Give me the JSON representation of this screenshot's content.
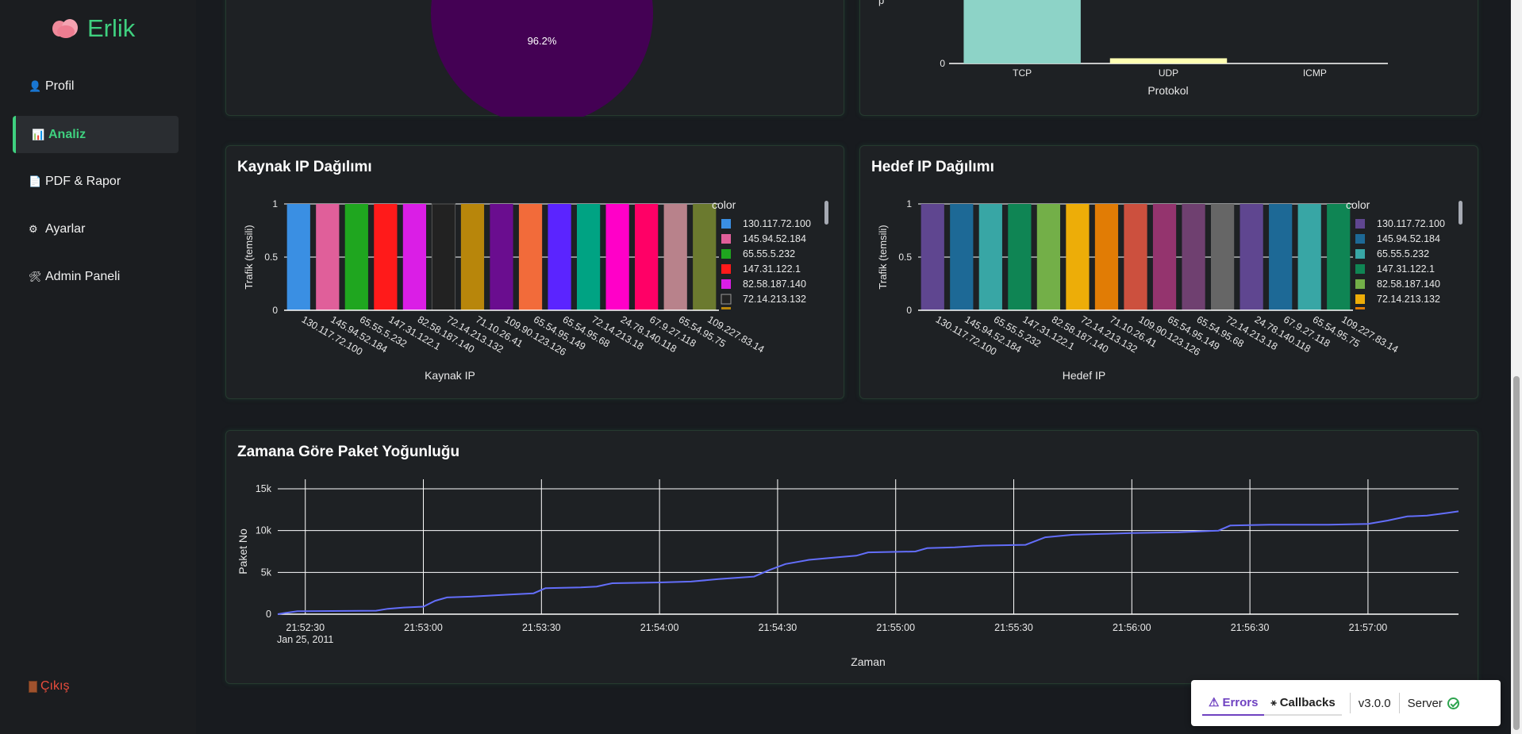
{
  "app": {
    "brand": "Erlik",
    "nav": [
      {
        "label": "Profil",
        "icon": "user-icon",
        "glyph": "👤"
      },
      {
        "label": "Analiz",
        "icon": "bar-chart-icon",
        "glyph": "📊"
      },
      {
        "label": "PDF & Rapor",
        "icon": "document-icon",
        "glyph": "📄"
      },
      {
        "label": "Ayarlar",
        "icon": "gear-icon",
        "glyph": "⚙"
      },
      {
        "label": "Admin Paneli",
        "icon": "tools-icon",
        "glyph": "🛠"
      }
    ],
    "logout": "Çıkış"
  },
  "pie_card": {
    "slice_label": "96.2%",
    "slice_color": "#440154"
  },
  "protocol_card": {
    "chart_data": {
      "type": "bar",
      "categories": [
        "TCP",
        "UDP",
        "ICMP"
      ],
      "values": [
        1,
        0.05,
        0
      ],
      "colors": [
        "#8dd3c7",
        "#ffffb3",
        "#bebada"
      ],
      "xlabel": "Protokol",
      "y_tick_visible": "0"
    }
  },
  "source_ip_card": {
    "title": "Kaynak IP Dağılımı",
    "chart_data": {
      "type": "bar",
      "categories": [
        "130.117.72.100",
        "145.94.52.184",
        "65.55.5.232",
        "147.31.122.1",
        "82.58.187.140",
        "72.14.213.132",
        "71.10.26.41",
        "109.90.123.126",
        "65.54.95.149",
        "65.54.95.68",
        "72.14.213.18",
        "24.78.140.118",
        "67.9.27.118",
        "65.54.95.75",
        "109.227.83.14"
      ],
      "values": [
        1,
        1,
        1,
        1,
        1,
        1,
        1,
        1,
        1,
        1,
        1,
        1,
        1,
        1,
        1
      ],
      "colors": [
        "#3a8fe3",
        "#e05f9a",
        "#1fa61f",
        "#ff1a1a",
        "#da1ee6",
        "#222222",
        "#b8860b",
        "#6a0d8f",
        "#f26b3a",
        "#5b24ff",
        "#00a383",
        "#ff00c8",
        "#ff0066",
        "#b8828b",
        "#6b7a2f"
      ],
      "xlabel": "Kaynak IP",
      "ylabel": "Trafik (temsili)",
      "yticks": [
        "0",
        "0.5",
        "1"
      ],
      "legend_title": "color",
      "legend_visible": [
        "130.117.72.100",
        "145.94.52.184",
        "65.55.5.232",
        "147.31.122.1",
        "82.58.187.140",
        "72.14.213.132"
      ]
    }
  },
  "dest_ip_card": {
    "title": "Hedef IP Dağılımı",
    "chart_data": {
      "type": "bar",
      "categories": [
        "130.117.72.100",
        "145.94.52.184",
        "65.55.5.232",
        "147.31.122.1",
        "82.58.187.140",
        "72.14.213.132",
        "71.10.26.41",
        "109.90.123.126",
        "65.54.95.149",
        "65.54.95.68",
        "72.14.213.18",
        "24.78.140.118",
        "67.9.27.118",
        "65.54.95.75",
        "109.227.83.14"
      ],
      "values": [
        1,
        1,
        1,
        1,
        1,
        1,
        1,
        1,
        1,
        1,
        1,
        1,
        1,
        1,
        1
      ],
      "colors": [
        "#5f4690",
        "#1d6996",
        "#38a6a5",
        "#0f8554",
        "#73af48",
        "#edad08",
        "#e17c05",
        "#cc503e",
        "#94346e",
        "#6f4070",
        "#666666",
        "#5f4690",
        "#1d6996",
        "#38a6a5",
        "#0f8554"
      ],
      "xlabel": "Hedef IP",
      "ylabel": "Trafik (temsili)",
      "yticks": [
        "0",
        "0.5",
        "1"
      ],
      "legend_title": "color",
      "legend_visible": [
        "130.117.72.100",
        "145.94.52.184",
        "65.55.5.232",
        "147.31.122.1",
        "82.58.187.140",
        "72.14.213.132"
      ]
    }
  },
  "timeline_card": {
    "title": "Zamana Göre Paket Yoğunluğu",
    "chart_data": {
      "type": "line",
      "xlabel": "Zaman",
      "ylabel": "Paket No",
      "date_label": "Jan 25, 2011",
      "x_ticks": [
        "21:52:30",
        "21:53:00",
        "21:53:30",
        "21:54:00",
        "21:54:30",
        "21:55:00",
        "21:55:30",
        "21:56:00",
        "21:56:30",
        "21:57:00"
      ],
      "y_ticks": [
        "0",
        "5k",
        "10k",
        "15k"
      ],
      "ylim": [
        0,
        15000
      ],
      "x_range": [
        "21:52:23",
        "21:57:23"
      ],
      "line_color": "#636efa",
      "series": [
        {
          "values": [
            [
              "21:52:23",
              0
            ],
            [
              "21:52:25",
              150
            ],
            [
              "21:52:28",
              350
            ],
            [
              "21:52:48",
              420
            ],
            [
              "21:52:51",
              650
            ],
            [
              "21:52:55",
              800
            ],
            [
              "21:53:00",
              900
            ],
            [
              "21:53:03",
              1600
            ],
            [
              "21:53:06",
              2000
            ],
            [
              "21:53:12",
              2100
            ],
            [
              "21:53:20",
              2300
            ],
            [
              "21:53:28",
              2500
            ],
            [
              "21:53:31",
              3100
            ],
            [
              "21:53:40",
              3200
            ],
            [
              "21:53:44",
              3300
            ],
            [
              "21:53:48",
              3700
            ],
            [
              "21:54:00",
              3800
            ],
            [
              "21:54:08",
              3900
            ],
            [
              "21:54:15",
              4200
            ],
            [
              "21:54:24",
              4500
            ],
            [
              "21:54:28",
              5300
            ],
            [
              "21:54:32",
              6000
            ],
            [
              "21:54:38",
              6500
            ],
            [
              "21:54:45",
              6800
            ],
            [
              "21:54:50",
              7000
            ],
            [
              "21:54:53",
              7400
            ],
            [
              "21:55:05",
              7500
            ],
            [
              "21:55:08",
              7900
            ],
            [
              "21:55:15",
              8000
            ],
            [
              "21:55:22",
              8200
            ],
            [
              "21:55:33",
              8300
            ],
            [
              "21:55:38",
              9200
            ],
            [
              "21:55:45",
              9500
            ],
            [
              "21:55:52",
              9600
            ],
            [
              "21:56:00",
              9700
            ],
            [
              "21:56:12",
              9800
            ],
            [
              "21:56:22",
              10000
            ],
            [
              "21:56:25",
              10600
            ],
            [
              "21:56:35",
              10700
            ],
            [
              "21:56:50",
              10700
            ],
            [
              "21:57:00",
              10800
            ],
            [
              "21:57:05",
              11200
            ],
            [
              "21:57:10",
              11700
            ],
            [
              "21:57:15",
              11800
            ],
            [
              "21:57:20",
              12100
            ],
            [
              "21:57:23",
              12300
            ]
          ]
        }
      ]
    }
  },
  "devtools": {
    "errors_label": "Errors",
    "callbacks_label": "Callbacks",
    "version": "v3.0.0",
    "server_label": "Server"
  }
}
